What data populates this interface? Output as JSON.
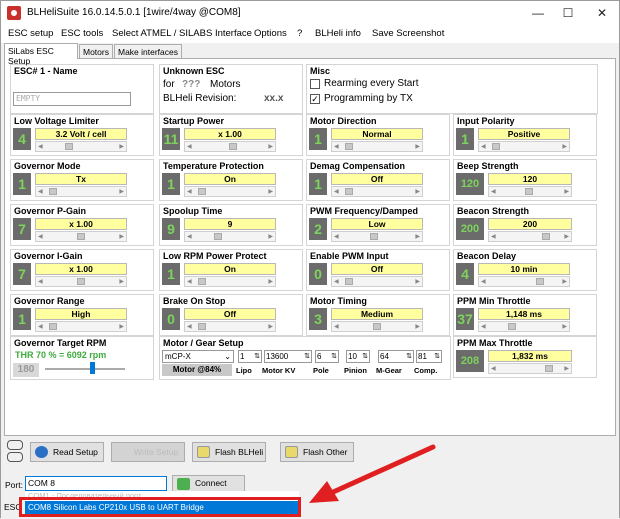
{
  "window": {
    "title": "BLHeliSuite 16.0.14.5.0.1  [1wire/4way @COM8]",
    "min": "—",
    "max": "☐",
    "close": "✕"
  },
  "menu": [
    "ESC setup",
    "ESC tools",
    "Select ATMEL / SILABS Interface",
    "Options",
    "?",
    "BLHeli info",
    "Save Screenshot"
  ],
  "tabs": [
    "SiLabs ESC Setup",
    "Motors",
    "Make interfaces"
  ],
  "esc_header": {
    "title": "ESC# 1 - Name",
    "name_value": "EMPTY"
  },
  "unknown": {
    "title": "Unknown ESC",
    "for_label": "for",
    "motors_q": "???",
    "motors_label": "Motors",
    "rev_label": "BLHeli Revision:",
    "rev_value": "xx.x"
  },
  "misc": {
    "title": "Misc",
    "rearming": "Rearming every Start",
    "rearming_checked": false,
    "programming": "Programming by TX",
    "programming_checked": true
  },
  "settings": [
    {
      "label": "Low Voltage Limiter",
      "box": "4",
      "value": "3.2 Volt / cell",
      "level": 0.3
    },
    {
      "label": "Startup Power",
      "box": "11",
      "value": "x 1.00",
      "level": 0.55
    },
    {
      "label": "Motor Direction",
      "box": "1",
      "value": "Normal",
      "level": 0.05
    },
    {
      "label": "Input Polarity",
      "box": "1",
      "value": "Positive",
      "level": 0.05
    },
    {
      "label": "Governor Mode",
      "box": "1",
      "value": "Tx",
      "level": 0.05
    },
    {
      "label": "Temperature Protection",
      "box": "1",
      "value": "On",
      "level": 0.05
    },
    {
      "label": "Demag Compensation",
      "box": "1",
      "value": "Off",
      "level": 0.05
    },
    {
      "label": "Beep Strength",
      "box": "120",
      "value": "120",
      "level": 0.48
    },
    {
      "label": "Governor P-Gain",
      "box": "7",
      "value": "x 1.00",
      "level": 0.5
    },
    {
      "label": "Spoolup Time",
      "box": "9",
      "value": "9",
      "level": 0.3
    },
    {
      "label": "PWM Frequency/Damped",
      "box": "2",
      "value": "Low",
      "level": 0.45
    },
    {
      "label": "Beacon Strength",
      "box": "200",
      "value": "200",
      "level": 0.8
    },
    {
      "label": "Governor I-Gain",
      "box": "7",
      "value": "x 1.00",
      "level": 0.5
    },
    {
      "label": "Low RPM Power Protect",
      "box": "1",
      "value": "On",
      "level": 0.05
    },
    {
      "label": "Enable PWM Input",
      "box": "0",
      "value": "Off",
      "level": 0.05
    },
    {
      "label": "Beacon Delay",
      "box": "4",
      "value": "10 min",
      "level": 0.75
    },
    {
      "label": "Governor Range",
      "box": "1",
      "value": "High",
      "level": 0.05
    },
    {
      "label": "Brake On Stop",
      "box": "0",
      "value": "Off",
      "level": 0.05
    },
    {
      "label": "Motor Timing",
      "box": "3",
      "value": "Medium",
      "level": 0.5
    },
    {
      "label": "PPM Min Throttle",
      "box": "37",
      "value": "1,148 ms",
      "level": 0.3
    },
    {
      "label": "PPM Max Throttle",
      "box": "208",
      "value": "1,832 ms",
      "level": 0.85
    }
  ],
  "gov_target": {
    "label": "Governor Target RPM",
    "text": "THR 70 % = 6092 rpm",
    "box": "180",
    "level": 0.6
  },
  "motor_gear": {
    "label": "Motor / Gear Setup",
    "preset": "mCP-X",
    "motor_pct": "Motor @84%",
    "lipo": "1",
    "kv": "13600",
    "pole": "6",
    "pinion": "10",
    "mgear": "64",
    "comp": "81",
    "sub_labels": [
      "Lipo",
      "Motor KV",
      "Pole",
      "Pinion",
      "M-Gear",
      "Comp."
    ]
  },
  "buttons": {
    "read": "Read Setup",
    "write": "Write Setup",
    "flash": "Flash BLHeli",
    "flash_other": "Flash Other",
    "connect": "Connect"
  },
  "port": {
    "label": "Port:",
    "value": "COM 8",
    "dropdown_option": "COM8    Silicon Labs CP210x USB to UART Bridge",
    "hidden_row": "COM1 - Последовательный порт",
    "esc_prefix": "ESC"
  }
}
